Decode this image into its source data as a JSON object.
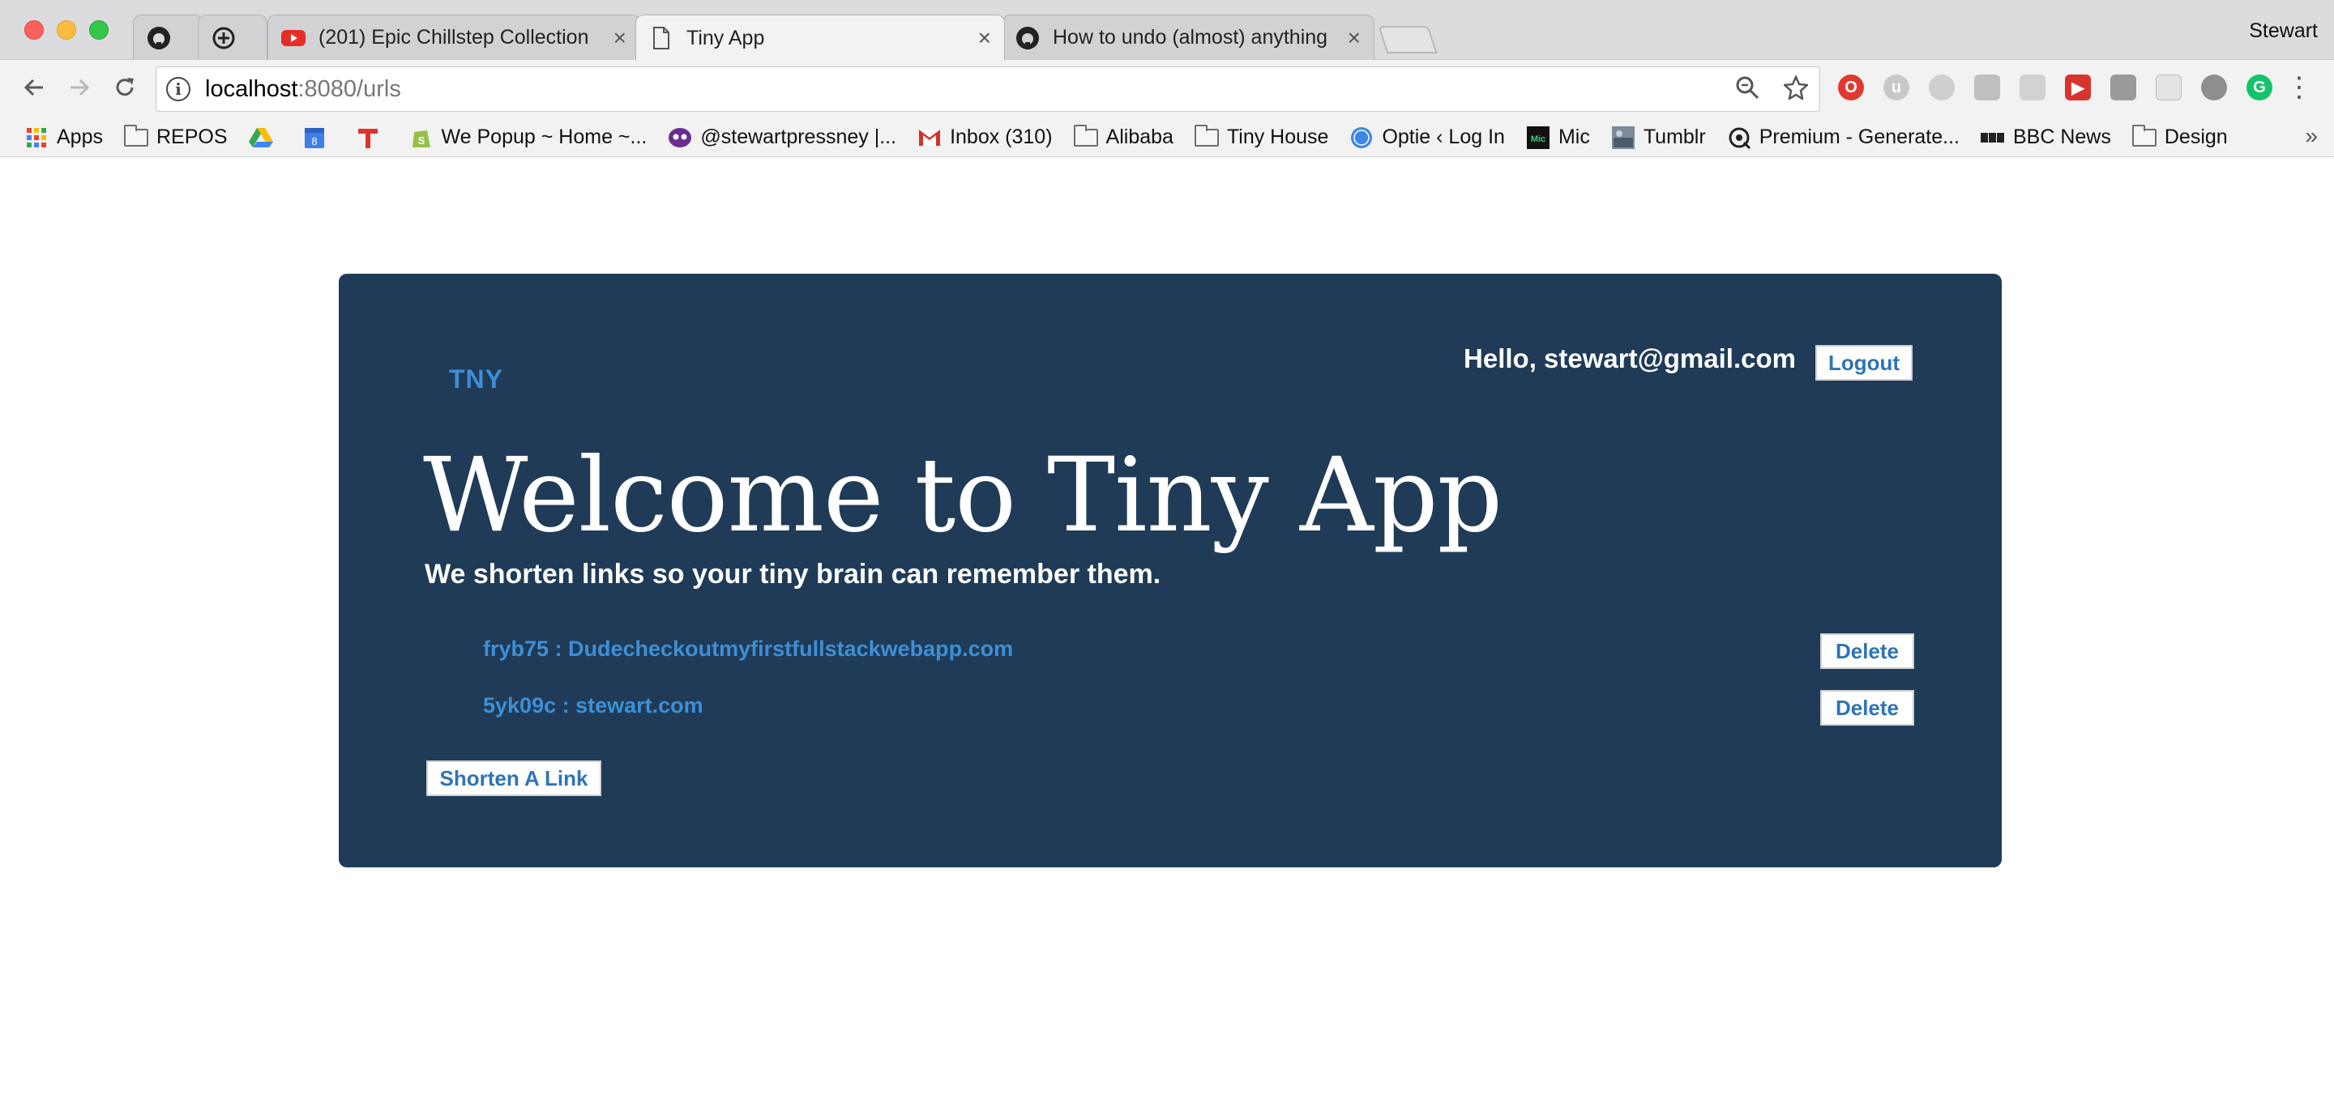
{
  "browser": {
    "tabs": [
      {
        "label": "",
        "icon": "github-icon"
      },
      {
        "label": "",
        "icon": "plus-circle-icon"
      },
      {
        "label": "(201) Epic Chillstep Collection",
        "icon": "youtube-icon"
      },
      {
        "label": "Tiny App",
        "icon": "page-icon"
      },
      {
        "label": "How to undo (almost) anything",
        "icon": "github-icon"
      }
    ],
    "profile_name": "Stewart",
    "url_host": "localhost",
    "url_path": ":8080/urls",
    "bookmarks": [
      {
        "label": "Apps",
        "icon": "apps-grid-icon"
      },
      {
        "label": "REPOS",
        "icon": "folder-icon"
      },
      {
        "label": "",
        "icon": "google-drive-icon"
      },
      {
        "label": "",
        "icon": "calendar-icon"
      },
      {
        "label": "",
        "icon": "t-logo-icon"
      },
      {
        "label": "We Popup ~ Home ~...",
        "icon": "shopify-icon"
      },
      {
        "label": "@stewartpressney |...",
        "icon": "bot-icon"
      },
      {
        "label": "Inbox (310)",
        "icon": "gmail-icon"
      },
      {
        "label": "Alibaba",
        "icon": "folder-icon"
      },
      {
        "label": "Tiny House",
        "icon": "folder-icon"
      },
      {
        "label": "Optie ‹ Log In",
        "icon": "wordpress-icon"
      },
      {
        "label": "Mic",
        "icon": "mic-icon"
      },
      {
        "label": "Tumblr",
        "icon": "tumblr-icon"
      },
      {
        "label": "Premium - Generate...",
        "icon": "premium-icon"
      },
      {
        "label": "BBC News",
        "icon": "bbc-icon"
      },
      {
        "label": "Design",
        "icon": "folder-icon"
      }
    ]
  },
  "app": {
    "brand": "TNY",
    "greeting": "Hello, stewart@gmail.com",
    "logout_label": "Logout",
    "title": "Welcome to Tiny App",
    "subtitle": "We shorten links so your tiny brain can remember them.",
    "urls": [
      {
        "text": "fryb75 : Dudecheckoutmyfirstfullstackwebapp.com",
        "delete_label": "Delete"
      },
      {
        "text": "5yk09c : stewart.com",
        "delete_label": "Delete"
      }
    ],
    "shorten_label": "Shorten A Link"
  },
  "colors": {
    "jumbotron": "#1f3b57",
    "link": "#3e8fd6",
    "button_text": "#2e74b5"
  }
}
